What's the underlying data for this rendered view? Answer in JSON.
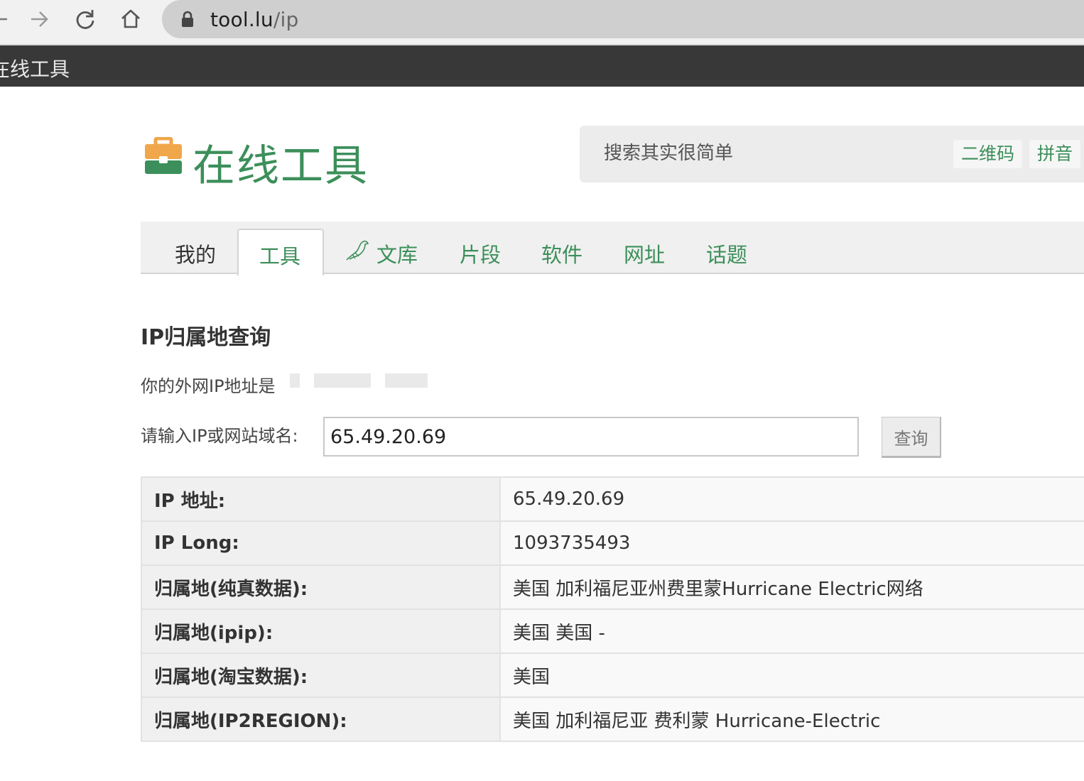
{
  "browser": {
    "url_host": "tool.lu",
    "url_path": "/ip"
  },
  "site": {
    "topbar_title": "在线工具",
    "logo_text": "在线工具",
    "search_placeholder": "搜索其实很简单",
    "search_tags": [
      "二维码",
      "拼音"
    ]
  },
  "tabs": [
    "我的",
    "工具",
    "文库",
    "片段",
    "软件",
    "网址",
    "话题"
  ],
  "active_tab": "工具",
  "main": {
    "page_title": "IP归属地查询",
    "my_ip_label": "你的外网IP地址是",
    "query_label": "请输入IP或网站域名:",
    "query_value": "65.49.20.69",
    "query_button": "查询"
  },
  "results": [
    {
      "label": "IP 地址:",
      "value": "65.49.20.69"
    },
    {
      "label": "IP Long:",
      "value": "1093735493"
    },
    {
      "label": "归属地(纯真数据):",
      "value": "美国 加利福尼亚州费里蒙Hurricane Electric网络"
    },
    {
      "label": "归属地(ipip):",
      "value": "美国 美国 -"
    },
    {
      "label": "归属地(淘宝数据):",
      "value": "美国"
    },
    {
      "label": "归属地(IP2REGION):",
      "value": "美国 加利福尼亚 费利蒙 Hurricane-Electric"
    }
  ],
  "colors": {
    "brand_green": "#3c8f5a",
    "logo_orange": "#f0a64a",
    "topbar": "#383838"
  },
  "icons": [
    "back-arrow-icon",
    "forward-arrow-icon",
    "reload-icon",
    "home-icon",
    "lock-icon",
    "toolbox-icon",
    "bird-icon"
  ]
}
